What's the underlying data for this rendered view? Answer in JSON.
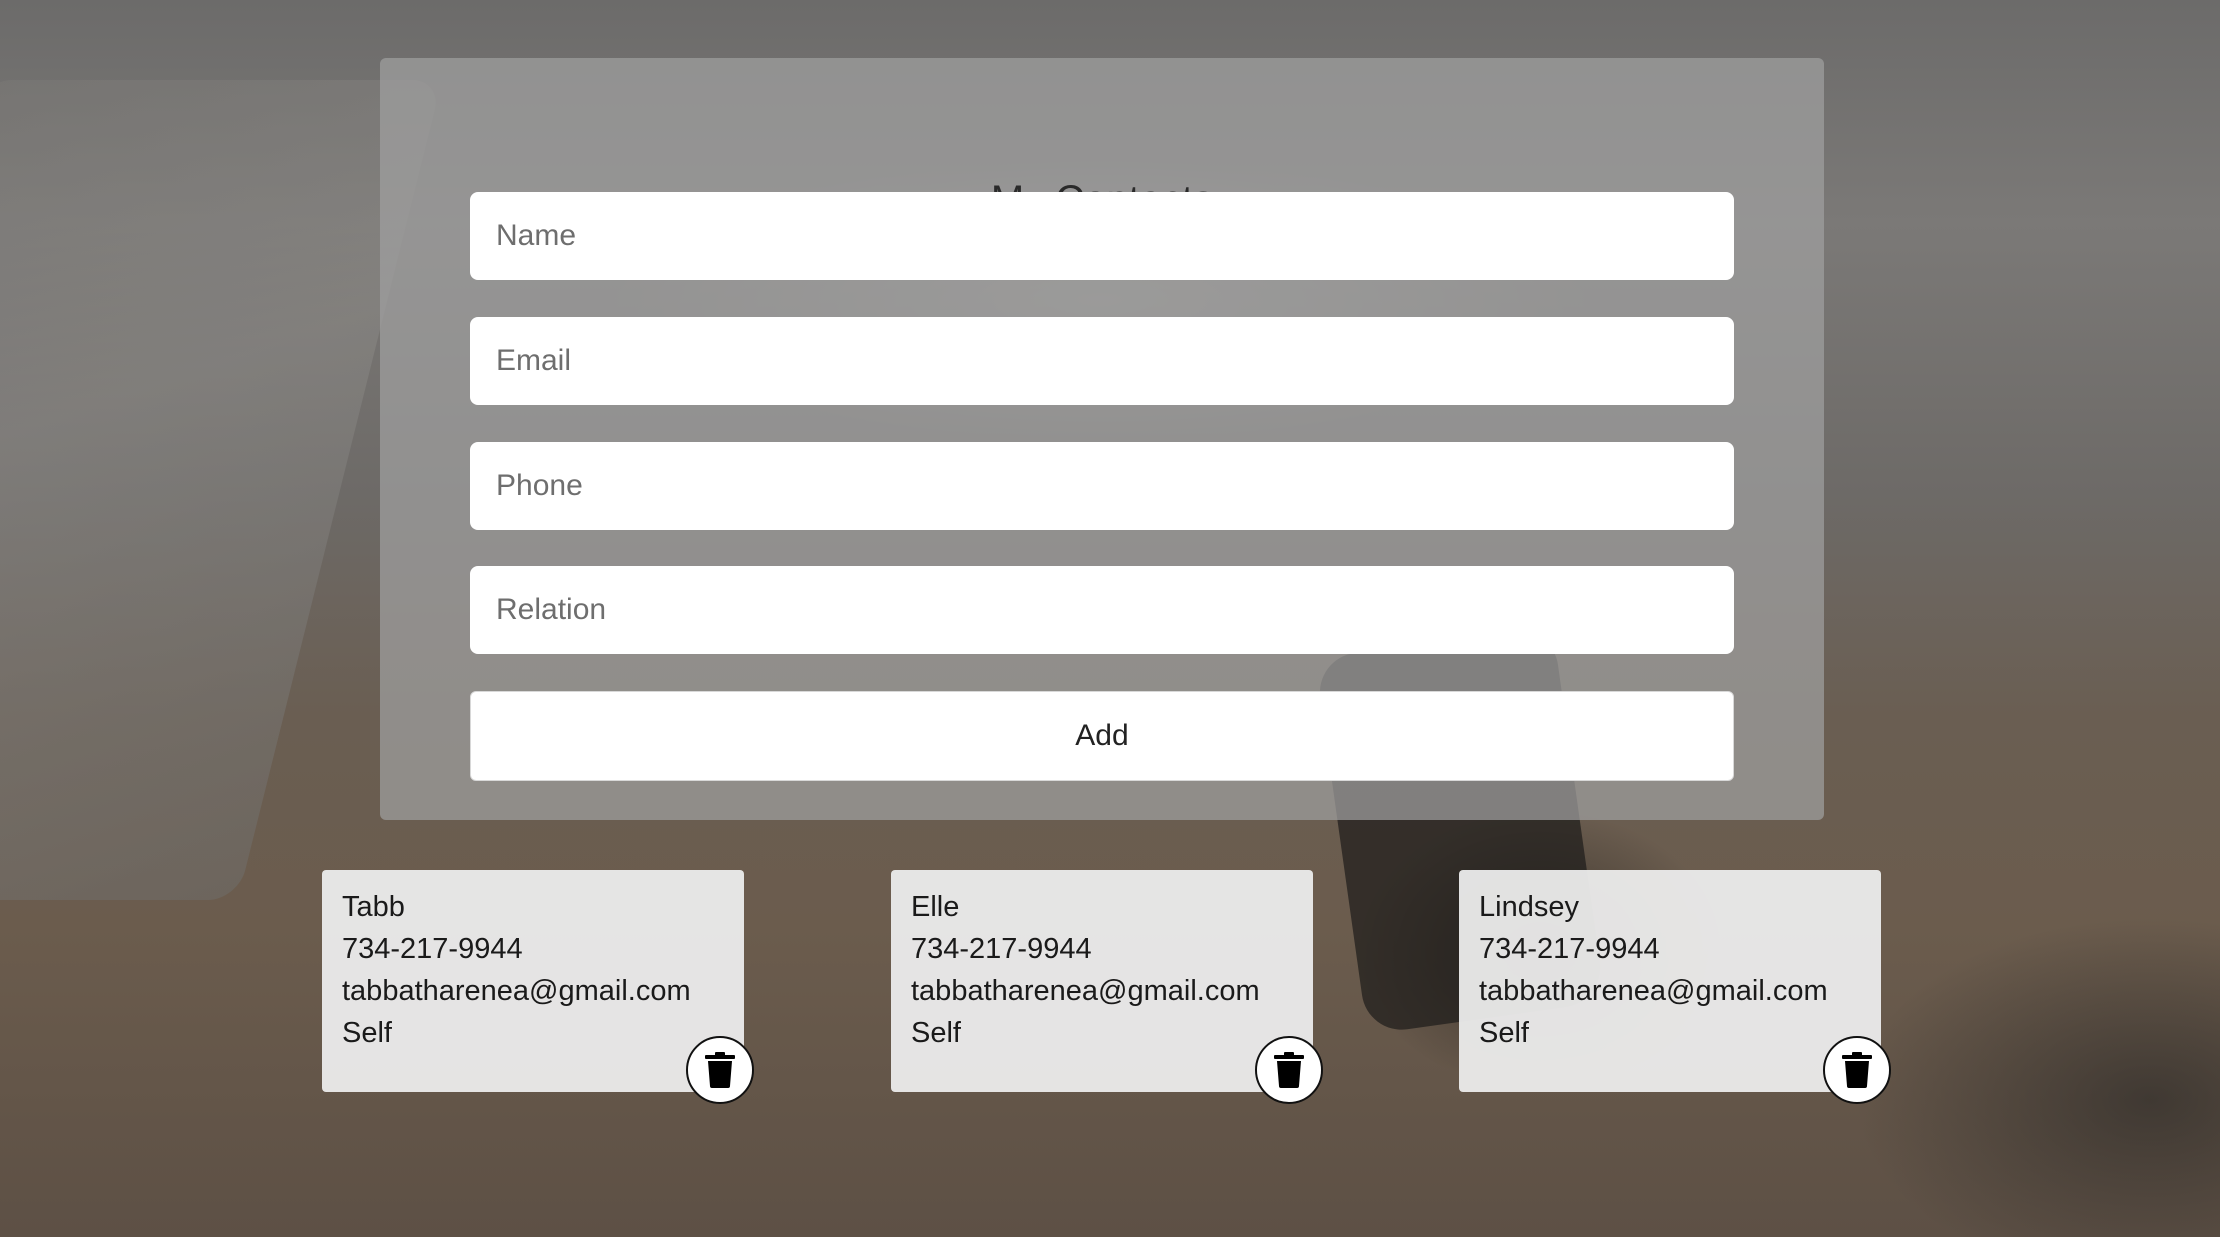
{
  "form": {
    "title": "My Contacts",
    "fields": {
      "name_placeholder": "Name",
      "email_placeholder": "Email",
      "phone_placeholder": "Phone",
      "relation_placeholder": "Relation"
    },
    "add_label": "Add"
  },
  "contacts": [
    {
      "name": "Tabb",
      "phone": "734-217-9944",
      "email": "tabbatharenea@gmail.com",
      "relation": "Self"
    },
    {
      "name": "Elle",
      "phone": "734-217-9944",
      "email": "tabbatharenea@gmail.com",
      "relation": "Self"
    },
    {
      "name": "Lindsey",
      "phone": "734-217-9944",
      "email": "tabbatharenea@gmail.com",
      "relation": "Self"
    }
  ],
  "icons": {
    "delete": "trash-icon"
  },
  "colors": {
    "panel": "#a0a0a0",
    "card": "#ececec",
    "text": "#1a1a1a"
  }
}
